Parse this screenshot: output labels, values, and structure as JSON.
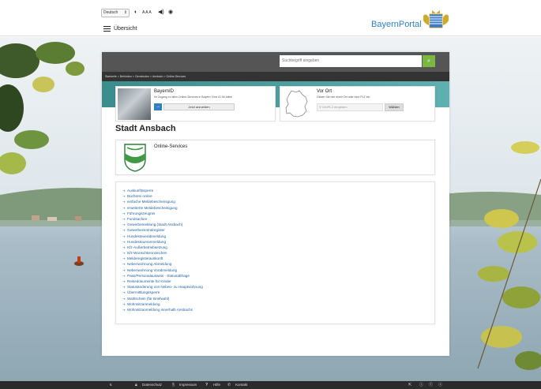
{
  "header": {
    "language": "Deutsch",
    "font_size_label": "A A A",
    "menu_label": "Übersicht",
    "brand": "BayernPortal"
  },
  "search": {
    "placeholder": "Suchbegriff eingeben"
  },
  "breadcrumb": "Startseite > Behörden > Gemeinden > Ansbach > Online-Services",
  "bayernid": {
    "title": "BayernID",
    "text": "Ihr Zugang zu allen Online-Services in Bayern: Eine ID für Alles!",
    "login_label": "Jetzt anmelden"
  },
  "vorort": {
    "title": "Vor Ort",
    "text": "Geben Sie hier einen Ort oder eine PLZ ein.",
    "placeholder": "Ort/PLZ eingeben",
    "button_label": "Wählen"
  },
  "page": {
    "title": "Stadt Ansbach",
    "services_label": "Online-Services"
  },
  "services": [
    "Auskunftssperre",
    "Bücherei online",
    "einfache Meldebescheinigung",
    "erweiterte Meldebescheinigung",
    "Führungszeugnis",
    "Fundsachen",
    "Gewerbemeldung (Stadt Ansbach)",
    "Gewerbezentralregister",
    "Hundesteuerabmeldung",
    "Hundesteueranmeldung",
    "Kfz-Außerbetriebsetzung",
    "Kfz-Wunschkennzeichen",
    "Melderegisterauskunft",
    "Nebenwohnung Abmeldung",
    "Nebenwohnung Vorabmeldung",
    "Pass/Personalausweis - Statusabfrage",
    "Reisedokumente für Kinder",
    "Statusänderung von Neben- zu Hauptwohnung",
    "Übermittlungssperre",
    "Wahlschein (für Briefwahl)",
    "Wohnsitzanmeldung",
    "Wohnsitzanmeldung innerhalb Ansbachs"
  ],
  "footer": {
    "datenschutz": "Datenschutz",
    "impressum": "Impressum",
    "hilfe": "Hilfe",
    "kontakt": "Kontakt"
  },
  "colors": {
    "brand_blue": "#2f7fc1",
    "search_green": "#7ab842",
    "teal": "#3a8d8c",
    "footer_bg": "#2b2b2b"
  }
}
